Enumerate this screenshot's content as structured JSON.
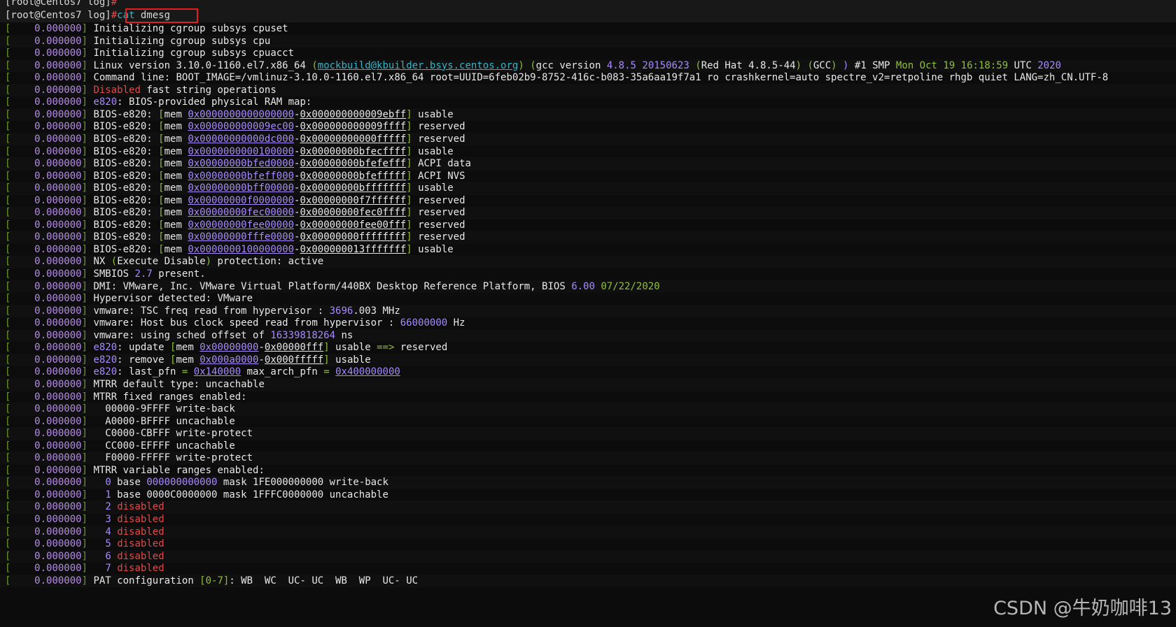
{
  "prompt1": {
    "user_host": "[root@Centos7 log]",
    "symbol": "#"
  },
  "prompt2": {
    "user_host": "[root@Centos7 log]",
    "symbol": "#",
    "command_word": "cat",
    "command_arg": " dmesg"
  },
  "watermark": "CSDN @牛奶咖啡13",
  "colors": {
    "background": "#0c0c0c",
    "bracket": "#6a9a2a",
    "timestamp": "#b48ce6",
    "link": "#38b3c6",
    "error": "#e04a4a",
    "highlight_box": "#e02020"
  },
  "log_timestamp": "0.000000",
  "log_lines": [
    [
      [
        "",
        "Initializing cgroup subsys cpuset"
      ]
    ],
    [
      [
        "",
        "Initializing cgroup subsys cpu"
      ]
    ],
    [
      [
        "",
        "Initializing cgroup subsys cpuacct"
      ]
    ],
    [
      [
        "",
        "Linux version 3.10.0-1160.el7.x86_64 "
      ],
      [
        "grn",
        "("
      ],
      [
        "link",
        "mockbuild@kbuilder.bsys.centos.org"
      ],
      [
        "grn",
        ")"
      ],
      [
        "",
        " "
      ],
      [
        "grn",
        "("
      ],
      [
        "",
        "gcc version "
      ],
      [
        "num",
        "4.8.5 20150623"
      ],
      [
        "",
        " "
      ],
      [
        "grn",
        "("
      ],
      [
        "",
        "Red Hat 4.8.5-44"
      ],
      [
        "grn",
        ")"
      ],
      [
        "",
        " "
      ],
      [
        "grn",
        "("
      ],
      [
        "",
        "GCC"
      ],
      [
        "grn",
        ")"
      ],
      [
        "",
        " "
      ],
      [
        "num",
        ")"
      ],
      [
        "",
        " #1 SMP "
      ],
      [
        "grn",
        "Mon Oct 19 16:18:59"
      ],
      [
        "",
        " UTC "
      ],
      [
        "num",
        "2020"
      ]
    ],
    [
      [
        "",
        "Command line: BOOT_IMAGE=/vmlinuz-3.10.0-1160.el7.x86_64 root=UUID=6feb02b9-8752-416c-b083-35a6aa19f7a1 ro crashkernel=auto spectre_v2=retpoline rhgb quiet LANG=zh_CN.UTF-8"
      ]
    ],
    [
      [
        "red",
        "Disabled"
      ],
      [
        "",
        " fast string operations"
      ]
    ],
    [
      [
        "num",
        "e820"
      ],
      [
        "",
        ": BIOS-provided physical RAM map:"
      ]
    ],
    [
      [
        "",
        "BIOS-e820: "
      ],
      [
        "grn",
        "["
      ],
      [
        "",
        "mem "
      ],
      [
        "addr",
        "0x0000000000000000"
      ],
      [
        "",
        "-"
      ],
      [
        "addrw",
        "0x000000000009ebff"
      ],
      [
        "grn",
        "]"
      ],
      [
        "",
        " usable"
      ]
    ],
    [
      [
        "",
        "BIOS-e820: "
      ],
      [
        "grn",
        "["
      ],
      [
        "",
        "mem "
      ],
      [
        "addr",
        "0x000000000009ec00"
      ],
      [
        "",
        "-"
      ],
      [
        "addrw",
        "0x000000000009ffff"
      ],
      [
        "grn",
        "]"
      ],
      [
        "",
        " reserved"
      ]
    ],
    [
      [
        "",
        "BIOS-e820: "
      ],
      [
        "grn",
        "["
      ],
      [
        "",
        "mem "
      ],
      [
        "addr",
        "0x00000000000dc000"
      ],
      [
        "",
        "-"
      ],
      [
        "addrw",
        "0x00000000000fffff"
      ],
      [
        "grn",
        "]"
      ],
      [
        "",
        " reserved"
      ]
    ],
    [
      [
        "",
        "BIOS-e820: "
      ],
      [
        "grn",
        "["
      ],
      [
        "",
        "mem "
      ],
      [
        "addr",
        "0x0000000000100000"
      ],
      [
        "",
        "-"
      ],
      [
        "addrw",
        "0x00000000bfecffff"
      ],
      [
        "grn",
        "]"
      ],
      [
        "",
        " usable"
      ]
    ],
    [
      [
        "",
        "BIOS-e820: "
      ],
      [
        "grn",
        "["
      ],
      [
        "",
        "mem "
      ],
      [
        "addr",
        "0x00000000bfed0000"
      ],
      [
        "",
        "-"
      ],
      [
        "addrw",
        "0x00000000bfefefff"
      ],
      [
        "grn",
        "]"
      ],
      [
        "",
        " ACPI data"
      ]
    ],
    [
      [
        "",
        "BIOS-e820: "
      ],
      [
        "grn",
        "["
      ],
      [
        "",
        "mem "
      ],
      [
        "addr",
        "0x00000000bfeff000"
      ],
      [
        "",
        "-"
      ],
      [
        "addrw",
        "0x00000000bfefffff"
      ],
      [
        "grn",
        "]"
      ],
      [
        "",
        " ACPI NVS"
      ]
    ],
    [
      [
        "",
        "BIOS-e820: "
      ],
      [
        "grn",
        "["
      ],
      [
        "",
        "mem "
      ],
      [
        "addr",
        "0x00000000bff00000"
      ],
      [
        "",
        "-"
      ],
      [
        "addrw",
        "0x00000000bfffffff"
      ],
      [
        "grn",
        "]"
      ],
      [
        "",
        " usable"
      ]
    ],
    [
      [
        "",
        "BIOS-e820: "
      ],
      [
        "grn",
        "["
      ],
      [
        "",
        "mem "
      ],
      [
        "addr",
        "0x00000000f0000000"
      ],
      [
        "",
        "-"
      ],
      [
        "addrw",
        "0x00000000f7ffffff"
      ],
      [
        "grn",
        "]"
      ],
      [
        "",
        " reserved"
      ]
    ],
    [
      [
        "",
        "BIOS-e820: "
      ],
      [
        "grn",
        "["
      ],
      [
        "",
        "mem "
      ],
      [
        "addr",
        "0x00000000fec00000"
      ],
      [
        "",
        "-"
      ],
      [
        "addrw",
        "0x00000000fec0ffff"
      ],
      [
        "grn",
        "]"
      ],
      [
        "",
        " reserved"
      ]
    ],
    [
      [
        "",
        "BIOS-e820: "
      ],
      [
        "grn",
        "["
      ],
      [
        "",
        "mem "
      ],
      [
        "addr",
        "0x00000000fee00000"
      ],
      [
        "",
        "-"
      ],
      [
        "addrw",
        "0x00000000fee00fff"
      ],
      [
        "grn",
        "]"
      ],
      [
        "",
        " reserved"
      ]
    ],
    [
      [
        "",
        "BIOS-e820: "
      ],
      [
        "grn",
        "["
      ],
      [
        "",
        "mem "
      ],
      [
        "addr",
        "0x00000000fffe0000"
      ],
      [
        "",
        "-"
      ],
      [
        "addrw",
        "0x00000000ffffffff"
      ],
      [
        "grn",
        "]"
      ],
      [
        "",
        " reserved"
      ]
    ],
    [
      [
        "",
        "BIOS-e820: "
      ],
      [
        "grn",
        "["
      ],
      [
        "",
        "mem "
      ],
      [
        "addr",
        "0x0000000100000000"
      ],
      [
        "",
        "-"
      ],
      [
        "addrw",
        "0x000000013fffffff"
      ],
      [
        "grn",
        "]"
      ],
      [
        "",
        " usable"
      ]
    ],
    [
      [
        "",
        "NX "
      ],
      [
        "grn",
        "("
      ],
      [
        "",
        "Execute Disable"
      ],
      [
        "grn",
        ")"
      ],
      [
        "",
        " protection: active"
      ]
    ],
    [
      [
        "",
        "SMBIOS "
      ],
      [
        "num",
        "2.7"
      ],
      [
        "",
        " present."
      ]
    ],
    [
      [
        "",
        "DMI: VMware, Inc. VMware Virtual Platform/440BX Desktop Reference Platform, BIOS "
      ],
      [
        "num",
        "6.00"
      ],
      [
        "",
        " "
      ],
      [
        "grn",
        "07/22/2020"
      ]
    ],
    [
      [
        "",
        "Hypervisor detected: VMware"
      ]
    ],
    [
      [
        "",
        "vmware: TSC freq read from hypervisor : "
      ],
      [
        "num",
        "3696"
      ],
      [
        "",
        ".003 MHz"
      ]
    ],
    [
      [
        "",
        "vmware: Host bus clock speed read from hypervisor : "
      ],
      [
        "num",
        "66000000"
      ],
      [
        "",
        " Hz"
      ]
    ],
    [
      [
        "",
        "vmware: using sched offset of "
      ],
      [
        "num",
        "16339818264"
      ],
      [
        "",
        " ns"
      ]
    ],
    [
      [
        "num",
        "e820"
      ],
      [
        "",
        ": update "
      ],
      [
        "grn",
        "["
      ],
      [
        "",
        "mem "
      ],
      [
        "addr",
        "0x00000000"
      ],
      [
        "",
        "-"
      ],
      [
        "addrw",
        "0x00000fff"
      ],
      [
        "grn",
        "]"
      ],
      [
        "",
        " usable "
      ],
      [
        "grn",
        "==>"
      ],
      [
        "",
        " reserved"
      ]
    ],
    [
      [
        "num",
        "e820"
      ],
      [
        "",
        ": remove "
      ],
      [
        "grn",
        "["
      ],
      [
        "",
        "mem "
      ],
      [
        "addr",
        "0x000a0000"
      ],
      [
        "",
        "-"
      ],
      [
        "addrw",
        "0x000fffff"
      ],
      [
        "grn",
        "]"
      ],
      [
        "",
        " usable"
      ]
    ],
    [
      [
        "num",
        "e820"
      ],
      [
        "",
        ": last_pfn "
      ],
      [
        "grn",
        "="
      ],
      [
        "",
        " "
      ],
      [
        "addr",
        "0x140000"
      ],
      [
        "",
        " max_arch_pfn "
      ],
      [
        "grn",
        "="
      ],
      [
        "",
        " "
      ],
      [
        "addr",
        "0x400000000"
      ]
    ],
    [
      [
        "",
        "MTRR default type: uncachable"
      ]
    ],
    [
      [
        "",
        "MTRR fixed ranges enabled:"
      ]
    ],
    [
      [
        "",
        "  00000-9FFFF write-back"
      ]
    ],
    [
      [
        "",
        "  A0000-BFFFF uncachable"
      ]
    ],
    [
      [
        "",
        "  C0000-CBFFF write-protect"
      ]
    ],
    [
      [
        "",
        "  CC000-EFFFF uncachable"
      ]
    ],
    [
      [
        "",
        "  F0000-FFFFF write-protect"
      ]
    ],
    [
      [
        "",
        "MTRR variable ranges enabled:"
      ]
    ],
    [
      [
        "",
        "  "
      ],
      [
        "num",
        "0"
      ],
      [
        "",
        " base "
      ],
      [
        "num",
        "000000000000"
      ],
      [
        "",
        " mask 1FE000000000 write-back"
      ]
    ],
    [
      [
        "",
        "  "
      ],
      [
        "num",
        "1"
      ],
      [
        "",
        " base 0000C0000000 mask 1FFFC0000000 uncachable"
      ]
    ],
    [
      [
        "",
        "  "
      ],
      [
        "num",
        "2"
      ],
      [
        "",
        " "
      ],
      [
        "red",
        "disabled"
      ]
    ],
    [
      [
        "",
        "  "
      ],
      [
        "num",
        "3"
      ],
      [
        "",
        " "
      ],
      [
        "red",
        "disabled"
      ]
    ],
    [
      [
        "",
        "  "
      ],
      [
        "num",
        "4"
      ],
      [
        "",
        " "
      ],
      [
        "red",
        "disabled"
      ]
    ],
    [
      [
        "",
        "  "
      ],
      [
        "num",
        "5"
      ],
      [
        "",
        " "
      ],
      [
        "red",
        "disabled"
      ]
    ],
    [
      [
        "",
        "  "
      ],
      [
        "num",
        "6"
      ],
      [
        "",
        " "
      ],
      [
        "red",
        "disabled"
      ]
    ],
    [
      [
        "",
        "  "
      ],
      [
        "num",
        "7"
      ],
      [
        "",
        " "
      ],
      [
        "red",
        "disabled"
      ]
    ],
    [
      [
        "",
        "PAT configuration "
      ],
      [
        "grn",
        "[0-7]"
      ],
      [
        "",
        ": WB  WC  UC- UC  WB  WP  UC- UC"
      ]
    ]
  ]
}
